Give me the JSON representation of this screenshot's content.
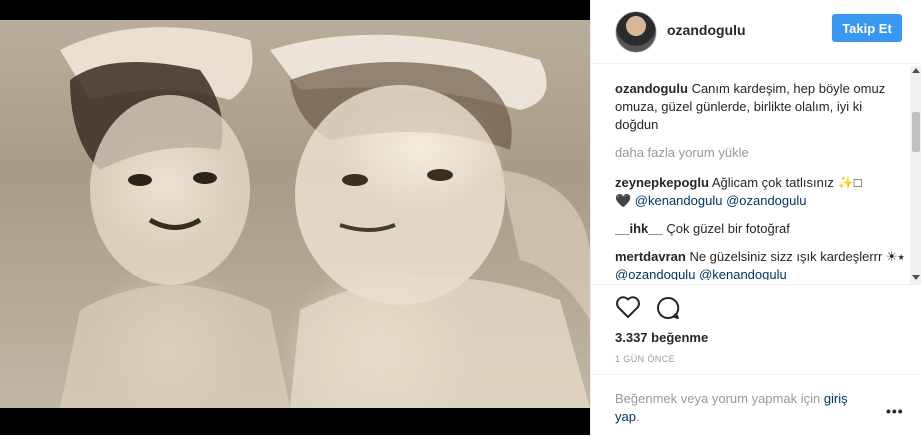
{
  "post": {
    "username": "ozandogulu",
    "follow_label": "Takip Et",
    "caption_user": "ozandogulu",
    "caption_text": "Canım kardeşim, hep böyle omuz omuza, güzel günlerde, birlikte olalım, iyi ki doğdun",
    "load_more": "daha fazla yorum yükle",
    "comments": [
      {
        "user": "zeynepkepoglu",
        "text": "Ağlicam çok tatlısınız ✨□",
        "line2": "🖤 @kenandogulu @ozandogulu"
      },
      {
        "user": "__ihk__",
        "text": "Çok güzel bir fotoğraf"
      },
      {
        "user": "mertdavran",
        "text": "Ne güzelsiniz sizz ışık kardeşlerrr ☀⭑",
        "mention1": "@ozandogulu",
        "mention2": "@kenandogulu"
      }
    ],
    "likes": "3.337 beğenme",
    "time": "1 GÜN ÖNCE",
    "footer_text": "Beğenmek veya yorum yapmak için ",
    "footer_link": "giriş yap",
    "footer_end": ".",
    "more_label": "•••"
  },
  "icons": {
    "heart": "heart-icon",
    "comment": "comment-icon",
    "more": "more-options-icon"
  },
  "colors": {
    "accent": "#3897f0",
    "link": "#003569",
    "muted": "#999999"
  }
}
